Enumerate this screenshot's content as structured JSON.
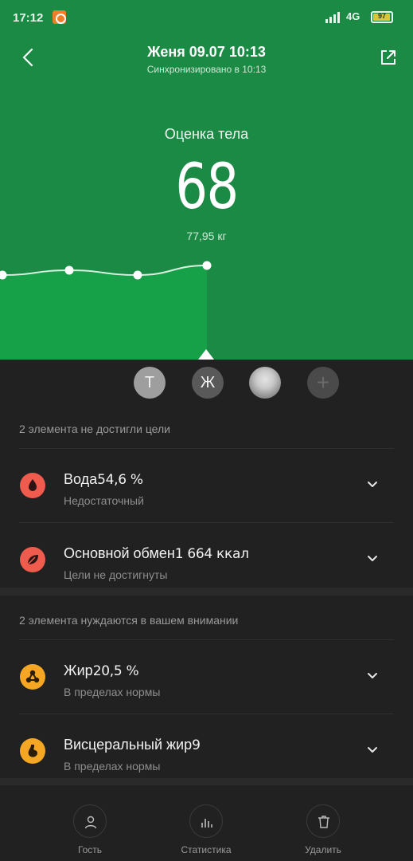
{
  "status_bar": {
    "time": "17:12",
    "network": "4G",
    "battery": "97",
    "battery_level": 0.97
  },
  "header": {
    "title": "Женя 09.07 10:13",
    "subtitle": "Синхронизировано в 10:13",
    "back_icon": "chevron-left-icon",
    "share_icon": "external-link-icon"
  },
  "score": {
    "label": "Оценка тела",
    "value": "68",
    "weight": "77,95 кг"
  },
  "trend": {
    "points": [
      66,
      67,
      66,
      68
    ]
  },
  "users": [
    {
      "initial": "Т",
      "state": "inactive"
    },
    {
      "initial": "Ж",
      "state": "active"
    },
    {
      "initial": "",
      "state": "photo"
    },
    {
      "initial": "+",
      "state": "add"
    }
  ],
  "sections": [
    {
      "title": "2 элемента не достигли цели",
      "items": [
        {
          "name": "Вода",
          "value": "54,6 %",
          "status": "Недостаточный",
          "icon": "water-drop-icon",
          "color": "#ef5b4c"
        },
        {
          "name": "Основной обмен",
          "value": "1 664 ккал",
          "status": "Цели не достигнуты",
          "icon": "leaf-icon",
          "color": "#ef5b4c"
        }
      ]
    },
    {
      "title": "2 элемента нуждаются в вашем внимании",
      "items": [
        {
          "name": "Жир",
          "value": "20,5 %",
          "status": "В пределах нормы",
          "icon": "molecule-icon",
          "color": "#f5a623"
        },
        {
          "name": "Висцеральный жир",
          "value": "9",
          "status": "В пределах нормы",
          "icon": "stomach-icon",
          "color": "#f5a623"
        }
      ]
    }
  ],
  "bottom_nav": [
    {
      "label": "Гость",
      "icon": "user-icon"
    },
    {
      "label": "Статистика",
      "icon": "bar-chart-icon"
    },
    {
      "label": "Удалить",
      "icon": "trash-icon"
    }
  ],
  "colors": {
    "header_green": "#1b8a45",
    "background": "#212121",
    "alert_red": "#ef5b4c",
    "warn_orange": "#f5a623"
  }
}
